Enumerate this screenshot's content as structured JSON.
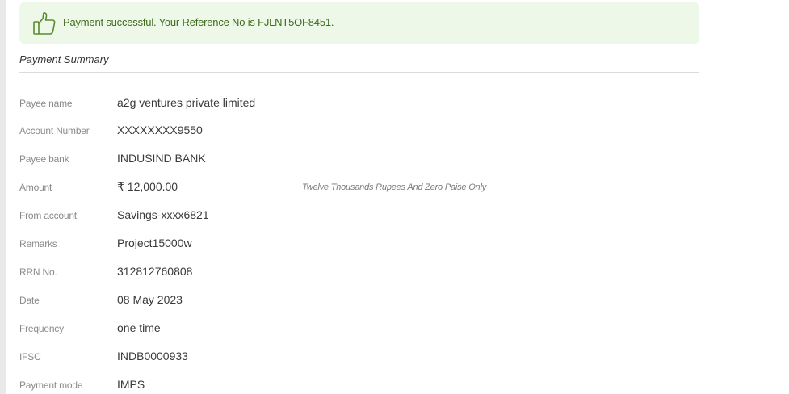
{
  "banner": {
    "icon": "thumbs-up-icon",
    "message": "Payment successful. Your Reference No is FJLNT5OF8451.",
    "accent_color": "#3f6b1f",
    "background_color": "#eef8e8"
  },
  "summary": {
    "title": "Payment Summary",
    "rows": [
      {
        "label": "Payee name",
        "value": "a2g ventures private limited"
      },
      {
        "label": "Account Number",
        "value": "XXXXXXXX9550"
      },
      {
        "label": "Payee bank",
        "value": "INDUSIND BANK"
      },
      {
        "label": "Amount",
        "value": "₹ 12,000.00",
        "words": "Twelve Thousands Rupees And Zero Paise Only"
      },
      {
        "label": "From account",
        "value": "Savings-xxxx6821"
      },
      {
        "label": "Remarks",
        "value": "Project15000w"
      },
      {
        "label": "RRN No.",
        "value": "312812760808"
      },
      {
        "label": "Date",
        "value": "08 May 2023"
      },
      {
        "label": "Frequency",
        "value": "one time"
      },
      {
        "label": "IFSC",
        "value": "INDB0000933"
      },
      {
        "label": "Payment mode",
        "value": "IMPS"
      }
    ]
  }
}
